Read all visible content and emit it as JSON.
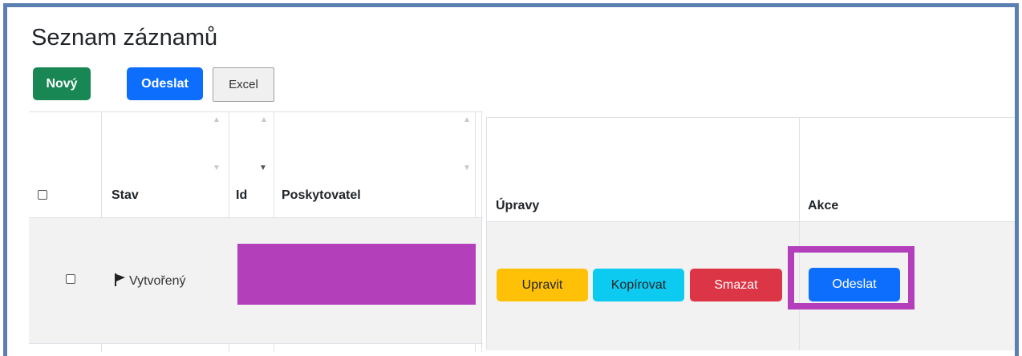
{
  "page": {
    "title": "Seznam záznamů"
  },
  "toolbar": {
    "new_label": "Nový",
    "send_label": "Odeslat",
    "excel_label": "Excel"
  },
  "table_left": {
    "columns": [
      "Stav",
      "Id",
      "Poskytovatel"
    ],
    "rows": [
      {
        "status": "Vytvořený",
        "id": "",
        "provider": ""
      }
    ]
  },
  "table_right": {
    "columns": [
      "Úpravy",
      "Akce"
    ],
    "row_actions": {
      "edit": "Upravit",
      "copy": "Kopírovat",
      "delete": "Smazat",
      "send": "Odeslat"
    }
  },
  "colors": {
    "primary": "#0d6efd",
    "success": "#198754",
    "warning": "#ffc107",
    "info": "#0dcaf0",
    "danger": "#dc3545",
    "highlight": "#b33fbb",
    "frame": "#5b7fb2"
  },
  "icons": {
    "status_flag": "flag-icon",
    "sort_asc": "sort-up-icon",
    "sort_desc": "sort-down-icon"
  }
}
